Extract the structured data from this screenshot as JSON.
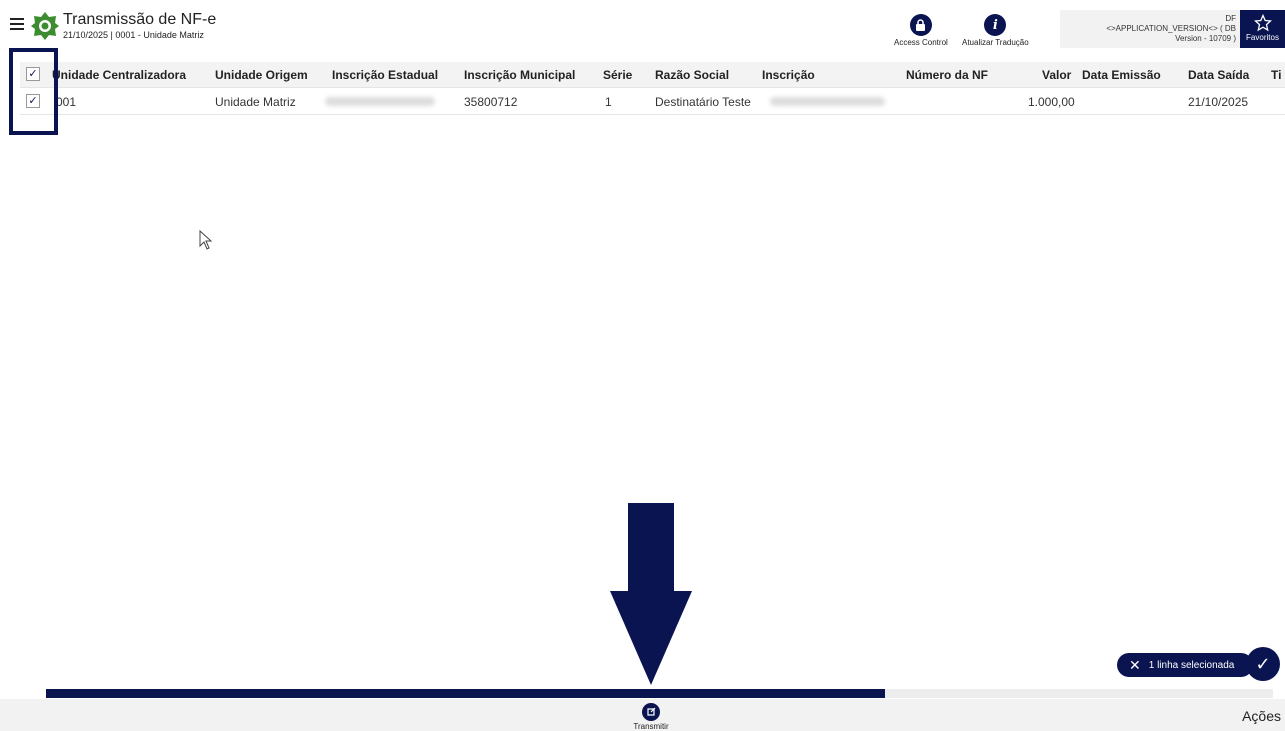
{
  "header": {
    "title": "Transmissão de NF-e",
    "subtitle": "21/10/2025 | 0001 - Unidade Matriz"
  },
  "tools": [
    {
      "label": "Access Control",
      "icon": "lock-icon"
    },
    {
      "label": "Atualizar Tradução",
      "icon": "info-icon"
    }
  ],
  "version": {
    "line1": "DF",
    "line2": "<>APPLICATION_VERSION<> ( DB",
    "line3": "Version - 10709 )"
  },
  "favorites_label": "Favoritos",
  "table": {
    "headers": [
      "Unidade Centralizadora",
      "Unidade Origem",
      "Inscrição Estadual",
      "Inscrição Municipal",
      "Série",
      "Razão Social",
      "Inscrição",
      "Número da NF",
      "Valor",
      "Data Emissão",
      "Data Saída",
      "Ti"
    ],
    "rows": [
      {
        "unidade_centralizadora": "001",
        "unidade_origem": "Unidade Matriz",
        "inscricao_estadual": "",
        "inscricao_municipal": "35800712",
        "serie": "1",
        "razao_social": "Destinatário Teste",
        "inscricao": "",
        "numero_nf": "",
        "valor": "1.000,00",
        "data_emissao": "",
        "data_saida": "21/10/2025",
        "checked": true
      }
    ],
    "header_checked": true
  },
  "selection": {
    "label": "1 linha selecionada"
  },
  "progress": {
    "fraction": 0.684
  },
  "bottom": {
    "transmit_label": "Transmitir",
    "actions_label": "Ações"
  },
  "colors": {
    "accent": "#0a1450",
    "logo": "#3d8c2f"
  }
}
